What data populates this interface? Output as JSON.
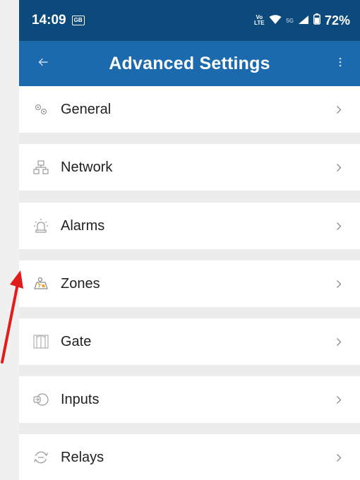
{
  "status_bar": {
    "time": "14:09",
    "sim_badge": "GB",
    "volte_label": "Vo LTE",
    "network_type": "5G",
    "battery": "72%"
  },
  "app_bar": {
    "title": "Advanced Settings",
    "back_icon": "arrow-left-icon",
    "menu_icon": "kebab-menu-icon"
  },
  "settings_items": [
    {
      "label": "General",
      "icon": "gears-icon"
    },
    {
      "label": "Network",
      "icon": "network-icon"
    },
    {
      "label": "Alarms",
      "icon": "siren-icon"
    },
    {
      "label": "Zones",
      "icon": "zones-icon"
    },
    {
      "label": "Gate",
      "icon": "gate-icon"
    },
    {
      "label": "Inputs",
      "icon": "input-icon"
    },
    {
      "label": "Relays",
      "icon": "relay-icon"
    }
  ],
  "colors": {
    "status_bar": "#0c4a7d",
    "app_bar": "#1a6aad",
    "row_background": "#ffffff",
    "list_background": "#ececec",
    "icon_gray": "#9a9a9a",
    "zone_accent": "#e8a23a",
    "annotation_arrow": "#e21b1b"
  }
}
